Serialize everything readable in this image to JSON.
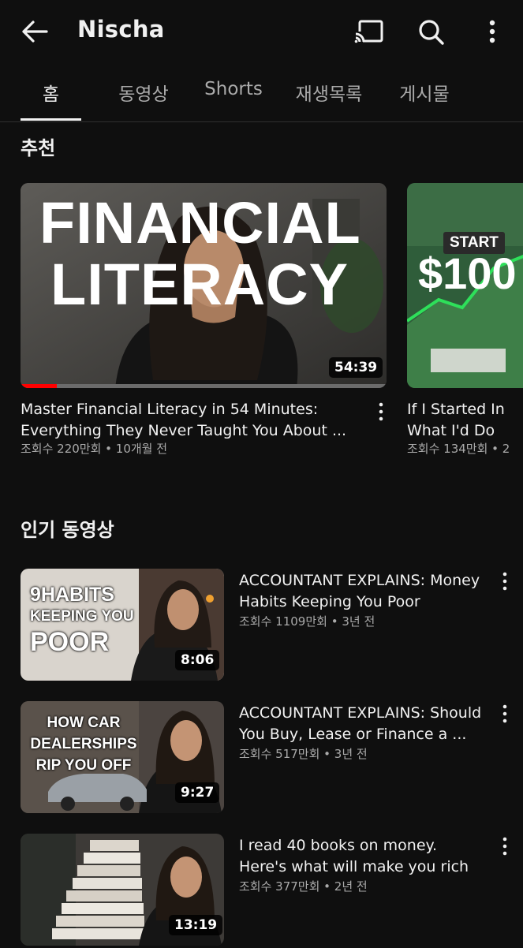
{
  "header": {
    "title": "Nischa"
  },
  "tabs": [
    {
      "label": "홈"
    },
    {
      "label": "동영상"
    },
    {
      "label": "Shorts"
    },
    {
      "label": "재생목록"
    },
    {
      "label": "게시물"
    }
  ],
  "recommended": {
    "heading": "추천",
    "videos": [
      {
        "thumb_text_1": "FINANCIAL",
        "thumb_text_2": "LITERACY",
        "duration": "54:39",
        "watched_fraction": 0.1,
        "title": "Master Financial Literacy in 54 Minutes: Everything They Never Taught You About ...",
        "meta": "조회수 220만회 • 10개월 전"
      },
      {
        "thumb_text_1": "START",
        "thumb_text_2": "$100",
        "title": "If I Started In What I'd Do",
        "meta": "조회수 134만회 • 2"
      }
    ]
  },
  "popular": {
    "heading": "인기 동영상",
    "videos": [
      {
        "thumb_text": [
          "9HABITS",
          "KEEPING YOU",
          "POOR"
        ],
        "duration": "8:06",
        "title": "ACCOUNTANT EXPLAINS: Money Habits Keeping You Poor",
        "meta": "조회수 1109만회 • 3년 전"
      },
      {
        "thumb_text": [
          "HOW CAR",
          "DEALERSHIPS",
          "RIP YOU OFF"
        ],
        "duration": "9:27",
        "title": "ACCOUNTANT EXPLAINS: Should You Buy, Lease or Finance a ...",
        "meta": "조회수 517만회 • 3년 전"
      },
      {
        "thumb_text": [],
        "duration": "13:19",
        "title": "I read 40 books on money. Here's what will make you rich",
        "meta": "조회수 377만회 • 2년 전"
      }
    ]
  },
  "colors": {
    "background": "#0f0f0f",
    "progress": "#ff0000",
    "meta": "#aaaaaa"
  }
}
